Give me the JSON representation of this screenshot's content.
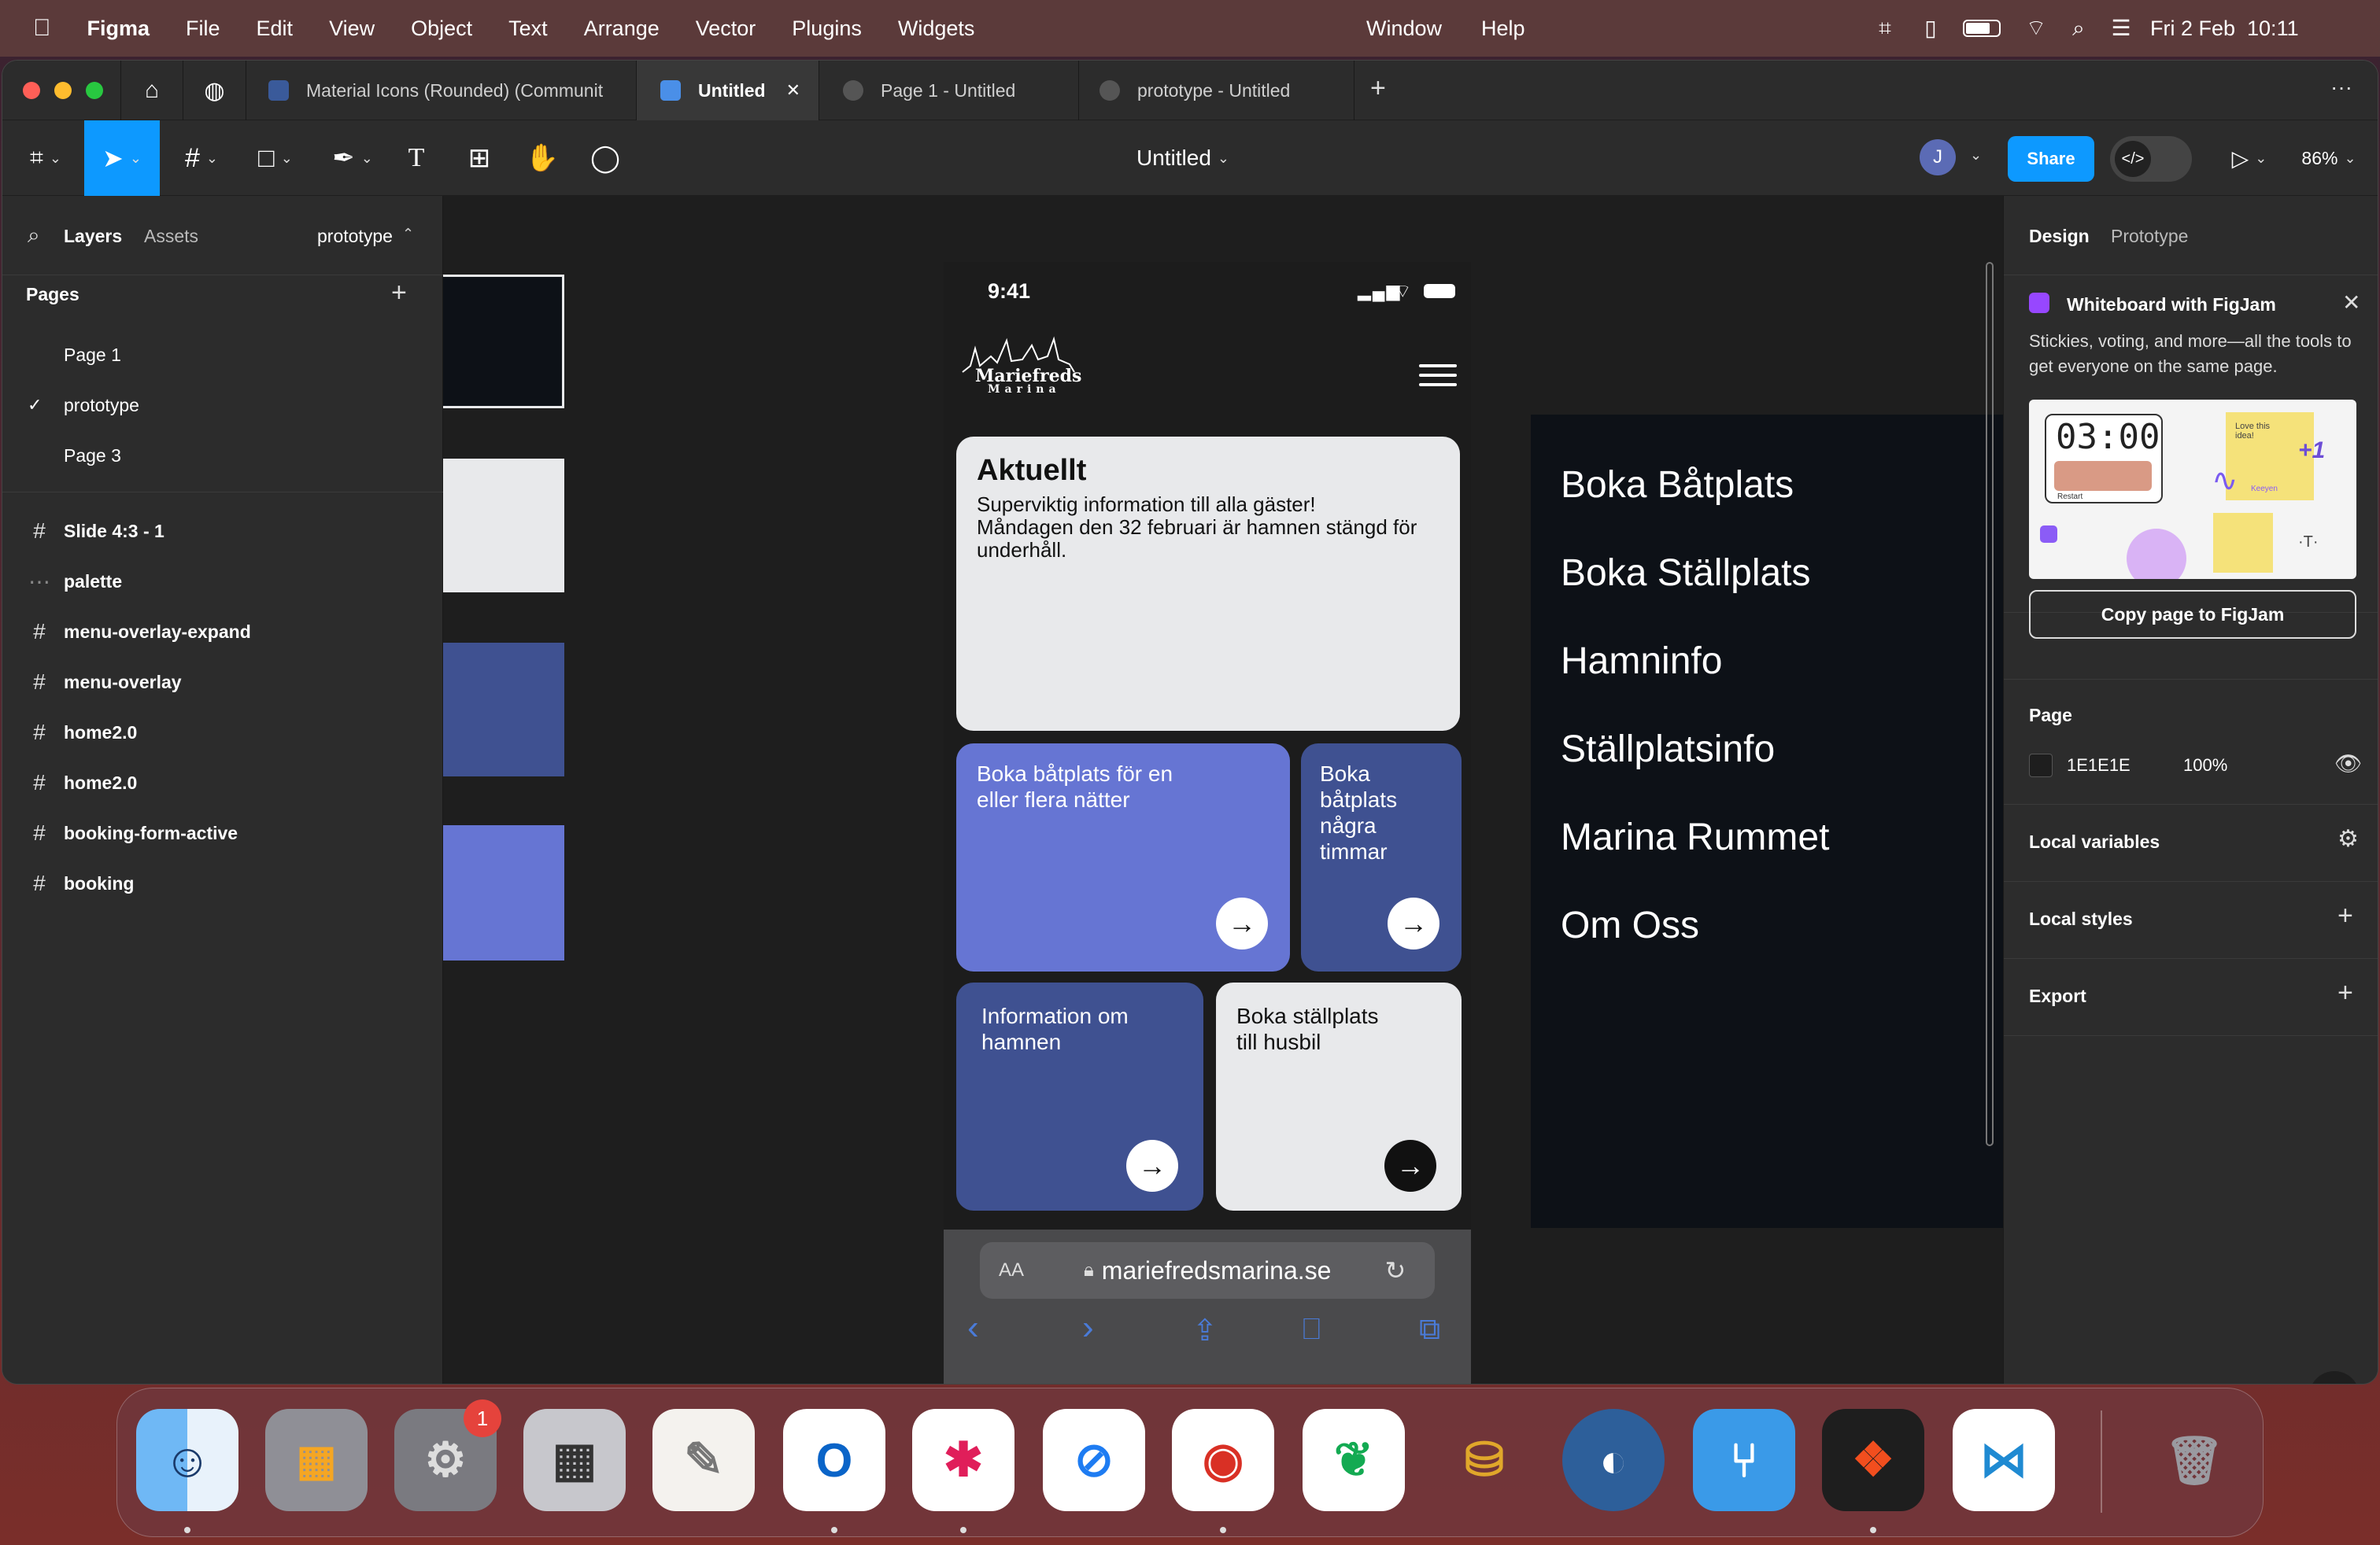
{
  "menubar": {
    "apple": "",
    "app": "Figma",
    "items": [
      "File",
      "Edit",
      "View",
      "Object",
      "Text",
      "Arrange",
      "Vector",
      "Plugins",
      "Widgets"
    ],
    "window": "Window",
    "help": "Help",
    "datetime": "Fri 2 Feb  10:11"
  },
  "tabs": [
    {
      "label": "Material Icons (Rounded) (Communit"
    },
    {
      "label": "Untitled",
      "close": "✕"
    },
    {
      "label": "Page 1 - Untitled"
    },
    {
      "label": "prototype - Untitled"
    }
  ],
  "tabs_add": "+",
  "tabs_more": "···",
  "toolbar": {
    "file_title": "Untitled",
    "avatar": "J",
    "share": "Share",
    "zoom": "86%"
  },
  "left": {
    "tab_layers": "Layers",
    "tab_assets": "Assets",
    "page_selector": "prototype",
    "pages_heading": "Pages",
    "pages_add": "+",
    "pages": [
      "Page 1",
      "prototype",
      "Page 3"
    ],
    "current_check": "✓",
    "layers": [
      {
        "icon": "#",
        "label": "Slide 4:3 - 1"
      },
      {
        "icon": "⋯",
        "label": "palette"
      },
      {
        "icon": "#",
        "label": "menu-overlay-expand"
      },
      {
        "icon": "#",
        "label": "menu-overlay"
      },
      {
        "icon": "#",
        "label": "home2.0"
      },
      {
        "icon": "#",
        "label": "home2.0"
      },
      {
        "icon": "#",
        "label": "booking-form-active"
      },
      {
        "icon": "#",
        "label": "booking"
      }
    ]
  },
  "palette_colors": [
    "#0d1117",
    "#e8e9eb",
    "#3f5191",
    "#6675d3"
  ],
  "phone": {
    "time": "9:41",
    "logo_line1": "Mariefreds",
    "logo_line2": "Marina",
    "card_main_title": "Aktuellt",
    "card_main_text": "Superviktig information till alla gäster! Måndagen den 32 februari är hamnen stängd för underhåll.",
    "card1": "Boka båtplats för en eller flera nätter",
    "card2": "Boka båtplats några timmar",
    "card3": "Information om hamnen",
    "card4": "Boka ställplats till husbil",
    "arrow": "→",
    "url": "mariefredsmarina.se",
    "aa": "AA"
  },
  "menu_overlay": [
    "Boka Båtplats",
    "Boka Ställplats",
    "Hamninfo",
    "Ställplatsinfo",
    "Marina Rummet",
    "Om Oss"
  ],
  "right": {
    "tab_design": "Design",
    "tab_prototype": "Prototype",
    "promo_title": "Whiteboard with FigJam",
    "promo_text": "Stickies, voting, and more—all the tools to get everyone on the same page.",
    "promo_timer": "03:00",
    "promo_restart": "Restart",
    "promo_note": "Love this idea!",
    "promo_plus": "+1",
    "promo_name": "Keeyen",
    "promo_t": "·T·",
    "copy_button": "Copy page to FigJam",
    "page_heading": "Page",
    "page_color": "1E1E1E",
    "page_opacity": "100%",
    "local_variables": "Local variables",
    "local_styles": "Local styles",
    "export": "Export",
    "plus": "+",
    "help": "?"
  },
  "dock": {
    "badge": "1"
  }
}
